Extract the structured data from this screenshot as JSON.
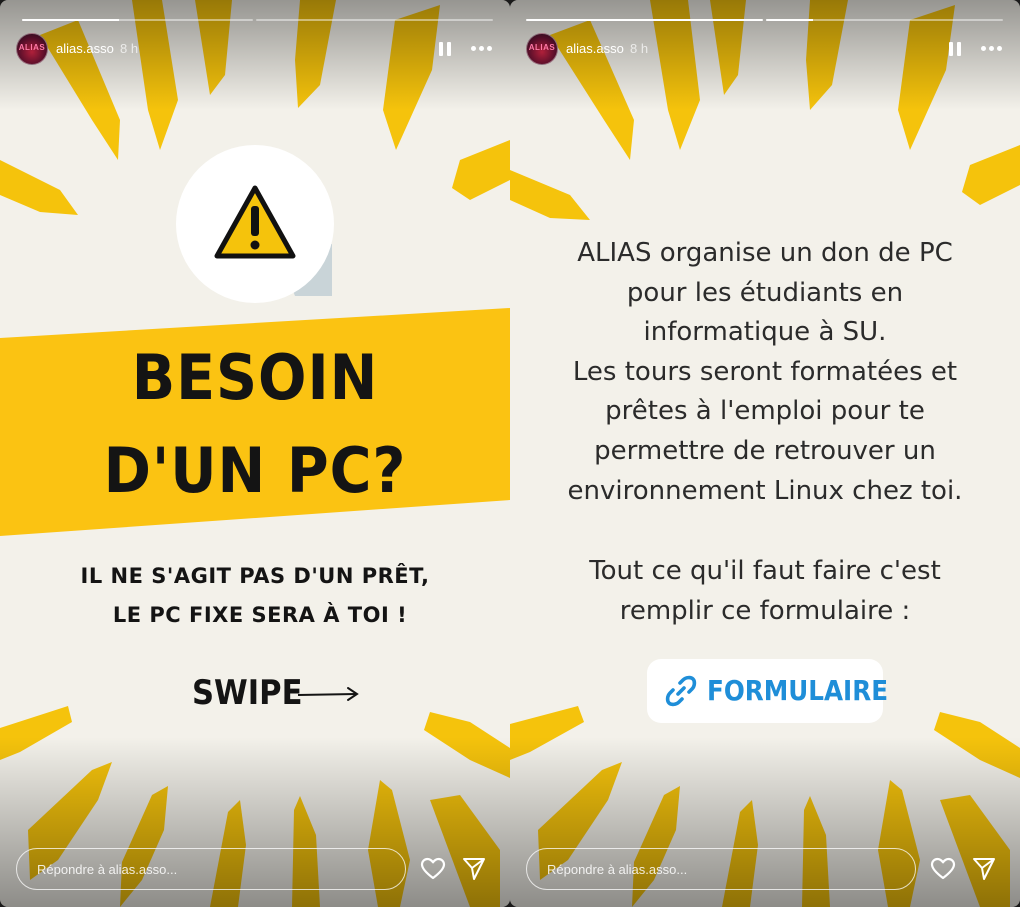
{
  "colors": {
    "story_background": "#f3f1ea",
    "ray_yellow": "#f5c30c",
    "banner_yellow": "#fbc312",
    "headline_text": "#141414",
    "body_text": "#2b2b2b",
    "link_blue": "#1f8ed8"
  },
  "stories": [
    {
      "account": {
        "username": "alias.asso",
        "time": "8 h",
        "avatar_text": "ALIAS"
      },
      "progress": [
        {
          "fraction": 0.42
        },
        {
          "fraction": 0
        }
      ],
      "warning_icon": "warning-triangle-icon",
      "headline": [
        "BESOIN",
        "D'UN PC?"
      ],
      "subtitle": [
        "IL NE S'AGIT PAS D'UN PRÊT,",
        "LE PC FIXE SERA À TOI !"
      ],
      "swipe_label": "SWIPE",
      "reply": {
        "placeholder": "Répondre à alias.asso..."
      }
    },
    {
      "account": {
        "username": "alias.asso",
        "time": "8 h",
        "avatar_text": "ALIAS"
      },
      "progress": [
        {
          "fraction": 1
        },
        {
          "fraction": 0.2
        }
      ],
      "body_paragraph_1": [
        "ALIAS organise un don de PC",
        "pour les étudiants en",
        "informatique à SU.",
        "Les tours seront formatées et",
        "prêtes à l'emploi pour te",
        "permettre de retrouver un",
        "environnement Linux chez toi."
      ],
      "body_paragraph_2": [
        "Tout ce qu'il faut faire c'est",
        "remplir ce formulaire :"
      ],
      "link_sticker": {
        "icon": "link-icon",
        "label": "FORMULAIRE"
      },
      "reply": {
        "placeholder": "Répondre à alias.asso..."
      }
    }
  ],
  "icons": {
    "pause": "pause-icon",
    "more": "more-dots-icon",
    "like": "heart-icon",
    "share": "send-icon"
  }
}
